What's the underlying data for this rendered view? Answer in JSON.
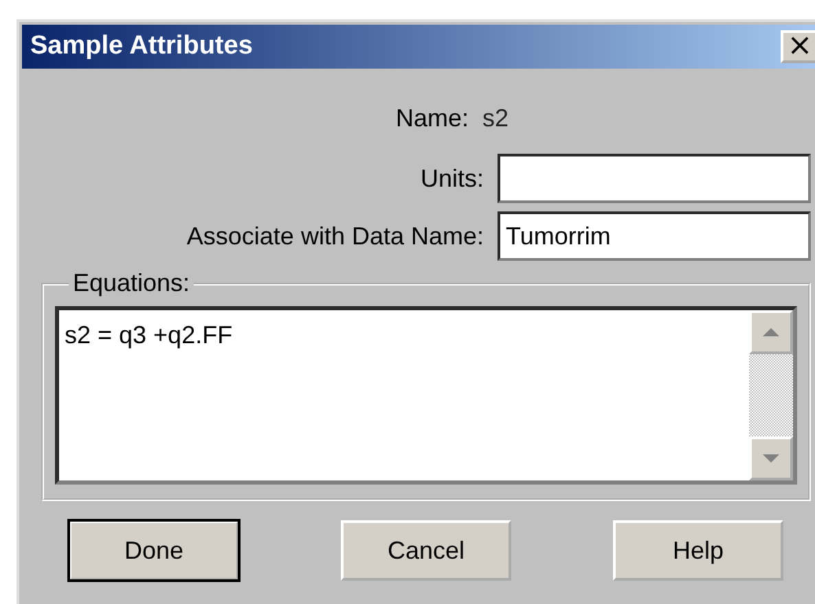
{
  "window": {
    "title": "Sample Attributes",
    "close": "×"
  },
  "name_label": "Name:",
  "name_value": "s2",
  "fields": [
    {
      "label": "Units:"
    },
    {
      "label": "Associate with Data Name:",
      "value": "Tumorrim"
    }
  ],
  "equations": {
    "legend": "Equations:",
    "text": "s2 = q3 +q2.FF"
  },
  "buttons": [
    {
      "label": "Done",
      "default": true
    },
    {
      "label": "Cancel",
      "default": false
    },
    {
      "label": "Help",
      "default": false
    }
  ]
}
